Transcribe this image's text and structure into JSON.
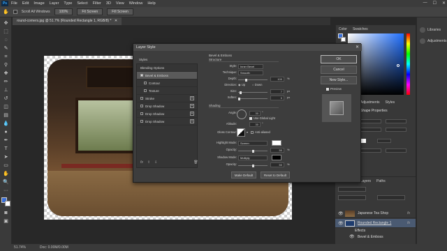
{
  "app": {
    "logo": "Ps"
  },
  "menu": [
    "File",
    "Edit",
    "Image",
    "Layer",
    "Type",
    "Select",
    "Filter",
    "3D",
    "View",
    "Window",
    "Help"
  ],
  "options": {
    "scroll_all": "Scroll All Windows",
    "zoom": "100%",
    "fit_screen": "Fit Screen",
    "fill_screen": "Fill Screen"
  },
  "document_tab": "round-corners.jpg @ 51.7% (Rounded Rectangle 1, RGB/8) *",
  "status": {
    "zoom": "51.74%",
    "doc": "Doc: 0.00M/0.00M"
  },
  "color_panel": {
    "tabs": [
      "Color",
      "Swatches"
    ]
  },
  "right_strip": [
    "Libraries",
    "Adjustments"
  ],
  "props_panel": {
    "tabs": [
      "Adjustments",
      "Styles"
    ],
    "title": "Shape Properties"
  },
  "layers_panel": {
    "tabs": [
      "Layers",
      "Paths"
    ],
    "rows": [
      {
        "name": "Japanese Tea Shop",
        "fx": "fx"
      },
      {
        "name": "Rounded Rectangle 1",
        "fx": "fx"
      },
      {
        "name": "Effects"
      },
      {
        "name": "Bevel & Emboss"
      }
    ]
  },
  "dialog": {
    "title": "Layer Style",
    "styles_header": "Styles",
    "items": [
      {
        "label": "Blending Options",
        "checkbox": false,
        "plus": false,
        "selected": false
      },
      {
        "label": "Bevel & Emboss",
        "checkbox": true,
        "plus": false,
        "selected": true
      },
      {
        "label": "Contour",
        "checkbox": true,
        "plus": false,
        "selected": false
      },
      {
        "label": "Texture",
        "checkbox": true,
        "plus": false,
        "selected": false
      },
      {
        "label": "Stroke",
        "checkbox": true,
        "plus": true,
        "selected": false
      },
      {
        "label": "Drop Shadow",
        "checkbox": true,
        "plus": true,
        "selected": false
      },
      {
        "label": "Drop Shadow",
        "checkbox": true,
        "plus": true,
        "selected": false
      },
      {
        "label": "Drop Shadow",
        "checkbox": true,
        "plus": true,
        "selected": false
      }
    ],
    "footer_fx": "fx",
    "section_title": "Bevel & Emboss",
    "structure": {
      "label": "Structure",
      "style_label": "Style:",
      "style_value": "Inner Bevel",
      "technique_label": "Technique:",
      "technique_value": "Smooth",
      "depth_label": "Depth:",
      "depth_value": "100",
      "depth_unit": "%",
      "direction_label": "Direction:",
      "up": "Up",
      "down": "Down",
      "size_label": "Size:",
      "size_value": "7",
      "size_unit": "px",
      "soften_label": "Soften:",
      "soften_value": "0",
      "soften_unit": "px"
    },
    "shading": {
      "label": "Shading",
      "angle_label": "Angle:",
      "angle_value": "30",
      "global_light": "Use Global Light",
      "altitude_label": "Altitude:",
      "altitude_value": "30",
      "gloss_label": "Gloss Contour:",
      "anti_aliased": "Anti-aliased",
      "highlight_label": "Highlight Mode:",
      "highlight_value": "Screen",
      "opacity1_label": "Opacity:",
      "opacity1_value": "50",
      "opacity1_unit": "%",
      "shadow_label": "Shadow Mode:",
      "shadow_value": "Multiply",
      "opacity2_label": "Opacity:",
      "opacity2_value": "50",
      "opacity2_unit": "%"
    },
    "make_default": "Make Default",
    "reset_default": "Reset to Default",
    "ok": "OK",
    "cancel": "Cancel",
    "new_style": "New Style...",
    "preview": "Preview"
  }
}
